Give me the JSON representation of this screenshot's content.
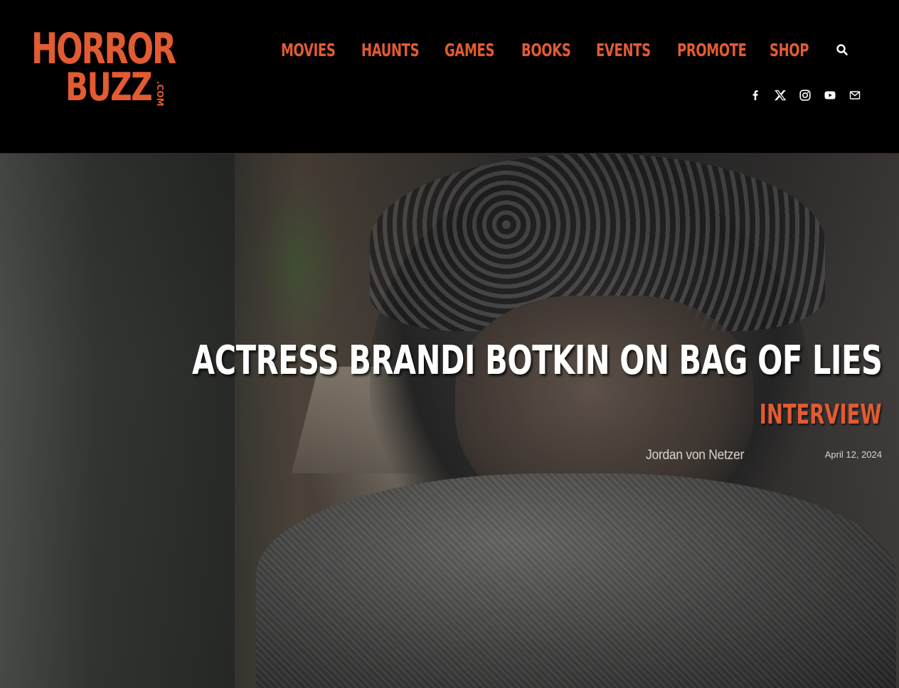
{
  "brand": {
    "logo_line1": "HORROR",
    "logo_line2": "BUZZ",
    "logo_suffix": ".COM",
    "accent_color": "#e25b32"
  },
  "nav": {
    "items": [
      "MOVIES",
      "HAUNTS",
      "GAMES",
      "BOOKS",
      "EVENTS",
      "PROMOTE",
      "SHOP"
    ],
    "search_icon": "search-icon"
  },
  "social": {
    "icons": [
      "facebook-icon",
      "x-twitter-icon",
      "instagram-icon",
      "youtube-icon",
      "email-icon"
    ]
  },
  "post": {
    "title": "ACTRESS BRANDI BOTKIN ON BAG OF LIES",
    "category": "INTERVIEW",
    "author": "Jordan von Netzer",
    "date": "April 12, 2024"
  }
}
